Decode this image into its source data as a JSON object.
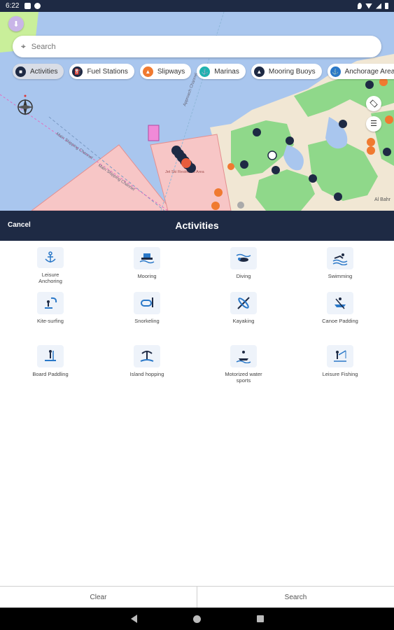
{
  "status_bar": {
    "time": "6:22"
  },
  "search": {
    "placeholder": "Search"
  },
  "filter_chips": [
    {
      "label": "Activities",
      "icon": "activities-icon",
      "color": "#1e2a44"
    },
    {
      "label": "Fuel Stations",
      "icon": "fuel-station-icon",
      "color": "#1e2a44"
    },
    {
      "label": "Slipways",
      "icon": "slipway-icon",
      "color": "#f07a30"
    },
    {
      "label": "Marinas",
      "icon": "marina-icon",
      "color": "#1fb3b0"
    },
    {
      "label": "Mooring Buoys",
      "icon": "mooring-buoy-icon",
      "color": "#1e2a44"
    },
    {
      "label": "Anchorage Area",
      "icon": "anchor-icon",
      "color": "#2a78c8"
    }
  ],
  "map": {
    "labels": {
      "jet_ski": "Jet Ski Restricted Area",
      "al_bahr": "Al Bahr",
      "channel_1": "Main Shipping Channel",
      "channel_2": "Main Shipping Channel",
      "channel_3": "Approach Channel"
    }
  },
  "sheet": {
    "cancel_label": "Cancel",
    "title": "Activities"
  },
  "activities": [
    {
      "label": "Leisure Anchoring",
      "icon": "anchor-icon"
    },
    {
      "label": "Mooring",
      "icon": "mooring-icon"
    },
    {
      "label": "Diving",
      "icon": "diving-icon"
    },
    {
      "label": "Swimming",
      "icon": "swimming-icon"
    },
    {
      "label": "Kite-surfing",
      "icon": "kite-surfing-icon"
    },
    {
      "label": "Snorkeling",
      "icon": "snorkeling-icon"
    },
    {
      "label": "Kayaking",
      "icon": "kayaking-icon"
    },
    {
      "label": "Canoe Padding",
      "icon": "canoe-icon"
    },
    {
      "label": "Board Paddling",
      "icon": "board-paddling-icon"
    },
    {
      "label": "Island hopping",
      "icon": "island-hopping-icon"
    },
    {
      "label": "Motorized water sports",
      "icon": "jet-ski-icon"
    },
    {
      "label": "Leisure Fishing",
      "icon": "fishing-icon"
    }
  ],
  "bottom": {
    "clear_label": "Clear",
    "search_label": "Search"
  },
  "colors": {
    "header": "#1e2a44",
    "accent": "#2a78c8",
    "water": "#a9c6ee",
    "land": "#8fd88a",
    "restricted": "#f7c6c6"
  }
}
